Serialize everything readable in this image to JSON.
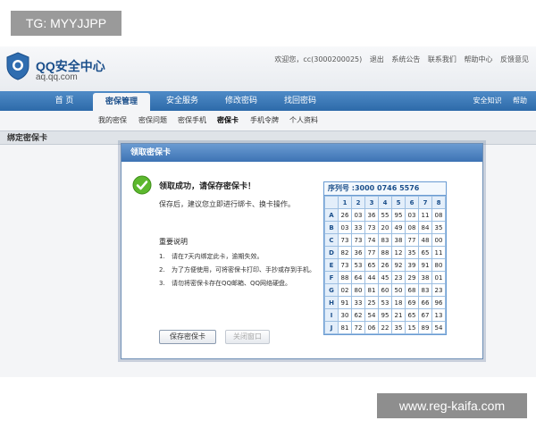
{
  "watermark": "TG: MYYJJPP",
  "site_url": "www.reg-kaifa.com",
  "header": {
    "brand": "QQ安全中心",
    "brand_sub": "aq.qq.com",
    "links": [
      "欢迎您，cc(3000200025)",
      "退出",
      "系统公告",
      "联系我们",
      "帮助中心",
      "反馈意见"
    ]
  },
  "nav": {
    "tabs": [
      "首 页",
      "密保管理",
      "安全服务",
      "修改密码",
      "找回密码"
    ],
    "active_tab": 1,
    "right": [
      "安全知识",
      "帮助"
    ]
  },
  "subnav": {
    "items": [
      "我的密保",
      "密保问题",
      "密保手机",
      "密保卡",
      "手机令牌",
      "个人资料"
    ],
    "active": 3
  },
  "section_title": "绑定密保卡",
  "modal": {
    "title": "领取密保卡",
    "success": "领取成功，请保存密保卡！",
    "tip": "保存后，建议您立即进行绑卡、换卡操作。",
    "notes_title": "重要说明",
    "notes": [
      {
        "num": "1.",
        "text": "请在7天内绑定此卡，逾期失效。"
      },
      {
        "num": "2.",
        "text": "为了方便使用，可将密保卡打印、手抄或存到手机。"
      },
      {
        "num": "3.",
        "text": "请勿将密保卡存在QQ邮箱、QQ网络硬盘。"
      }
    ],
    "buttons": {
      "save": "保存密保卡",
      "close": "关闭窗口"
    }
  },
  "card": {
    "serial": "序列号 :3000  0746  5576",
    "columns": [
      "1",
      "2",
      "3",
      "4",
      "5",
      "6",
      "7",
      "8"
    ],
    "rows": [
      {
        "label": "A",
        "values": [
          "26",
          "03",
          "36",
          "55",
          "95",
          "03",
          "11",
          "08"
        ]
      },
      {
        "label": "B",
        "values": [
          "03",
          "33",
          "73",
          "20",
          "49",
          "08",
          "84",
          "35"
        ]
      },
      {
        "label": "C",
        "values": [
          "73",
          "73",
          "74",
          "83",
          "38",
          "77",
          "48",
          "00"
        ]
      },
      {
        "label": "D",
        "values": [
          "82",
          "36",
          "77",
          "88",
          "12",
          "35",
          "65",
          "11"
        ]
      },
      {
        "label": "E",
        "values": [
          "73",
          "53",
          "65",
          "26",
          "92",
          "39",
          "91",
          "80"
        ]
      },
      {
        "label": "F",
        "values": [
          "88",
          "64",
          "44",
          "45",
          "23",
          "29",
          "38",
          "01"
        ]
      },
      {
        "label": "G",
        "values": [
          "02",
          "80",
          "81",
          "60",
          "50",
          "68",
          "83",
          "23"
        ]
      },
      {
        "label": "H",
        "values": [
          "91",
          "33",
          "25",
          "53",
          "18",
          "69",
          "66",
          "96"
        ]
      },
      {
        "label": "I",
        "values": [
          "30",
          "62",
          "54",
          "95",
          "21",
          "65",
          "67",
          "13"
        ]
      },
      {
        "label": "J",
        "values": [
          "81",
          "72",
          "06",
          "22",
          "35",
          "15",
          "89",
          "54"
        ]
      }
    ]
  }
}
